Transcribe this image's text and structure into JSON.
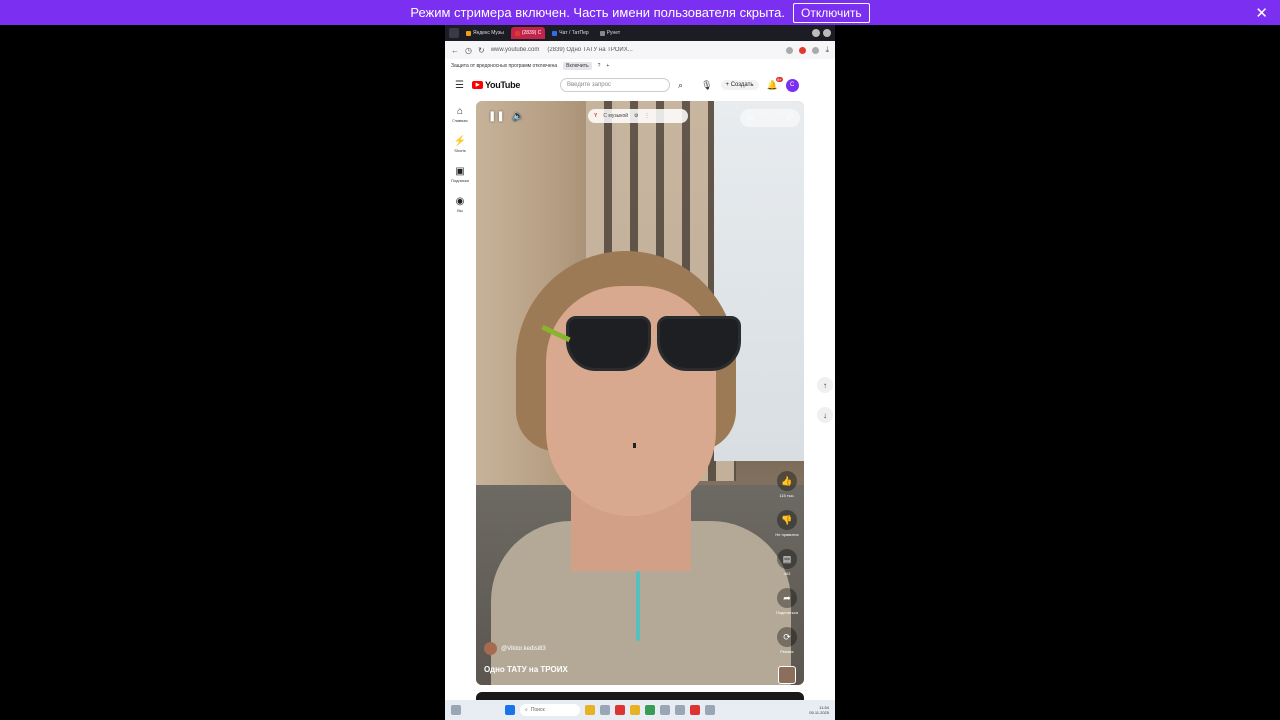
{
  "banner": {
    "text": "Режим стримера включен. Часть имени пользователя скрыта.",
    "button": "Отключить"
  },
  "browser": {
    "tabs": [
      {
        "label": "Яндекс Музы"
      },
      {
        "label": "(2839) С"
      },
      {
        "label": "Чат / ТатПер"
      },
      {
        "label": "Рунет"
      }
    ],
    "url": "www.youtube.com",
    "page_title": "(2839) Одно ТАТУ на ТРОИХ...",
    "info_text": "Защита от вредоносных программ отключена",
    "info_button": "Включить"
  },
  "youtube": {
    "logo": "YouTube",
    "search_placeholder": "Введите запрос",
    "create_label": "Создать",
    "notification_count": "9+",
    "avatar_letter": "C",
    "sidebar": [
      {
        "label": "Главная"
      },
      {
        "label": "Shorts"
      },
      {
        "label": "Подписки"
      },
      {
        "label": "Вы"
      }
    ]
  },
  "video": {
    "top_label": "С музыкой",
    "channel": "@Viktor.kedisi83",
    "title": "Одно ТАТУ на ТРОИХ",
    "actions": [
      {
        "label": "115 тыс."
      },
      {
        "label": "Не нравится"
      },
      {
        "label": "463"
      },
      {
        "label": "Поделиться"
      },
      {
        "label": "Ремикс"
      }
    ]
  },
  "taskbar": {
    "search": "Поиск",
    "time": "11:54",
    "date": "05.11.2025"
  }
}
